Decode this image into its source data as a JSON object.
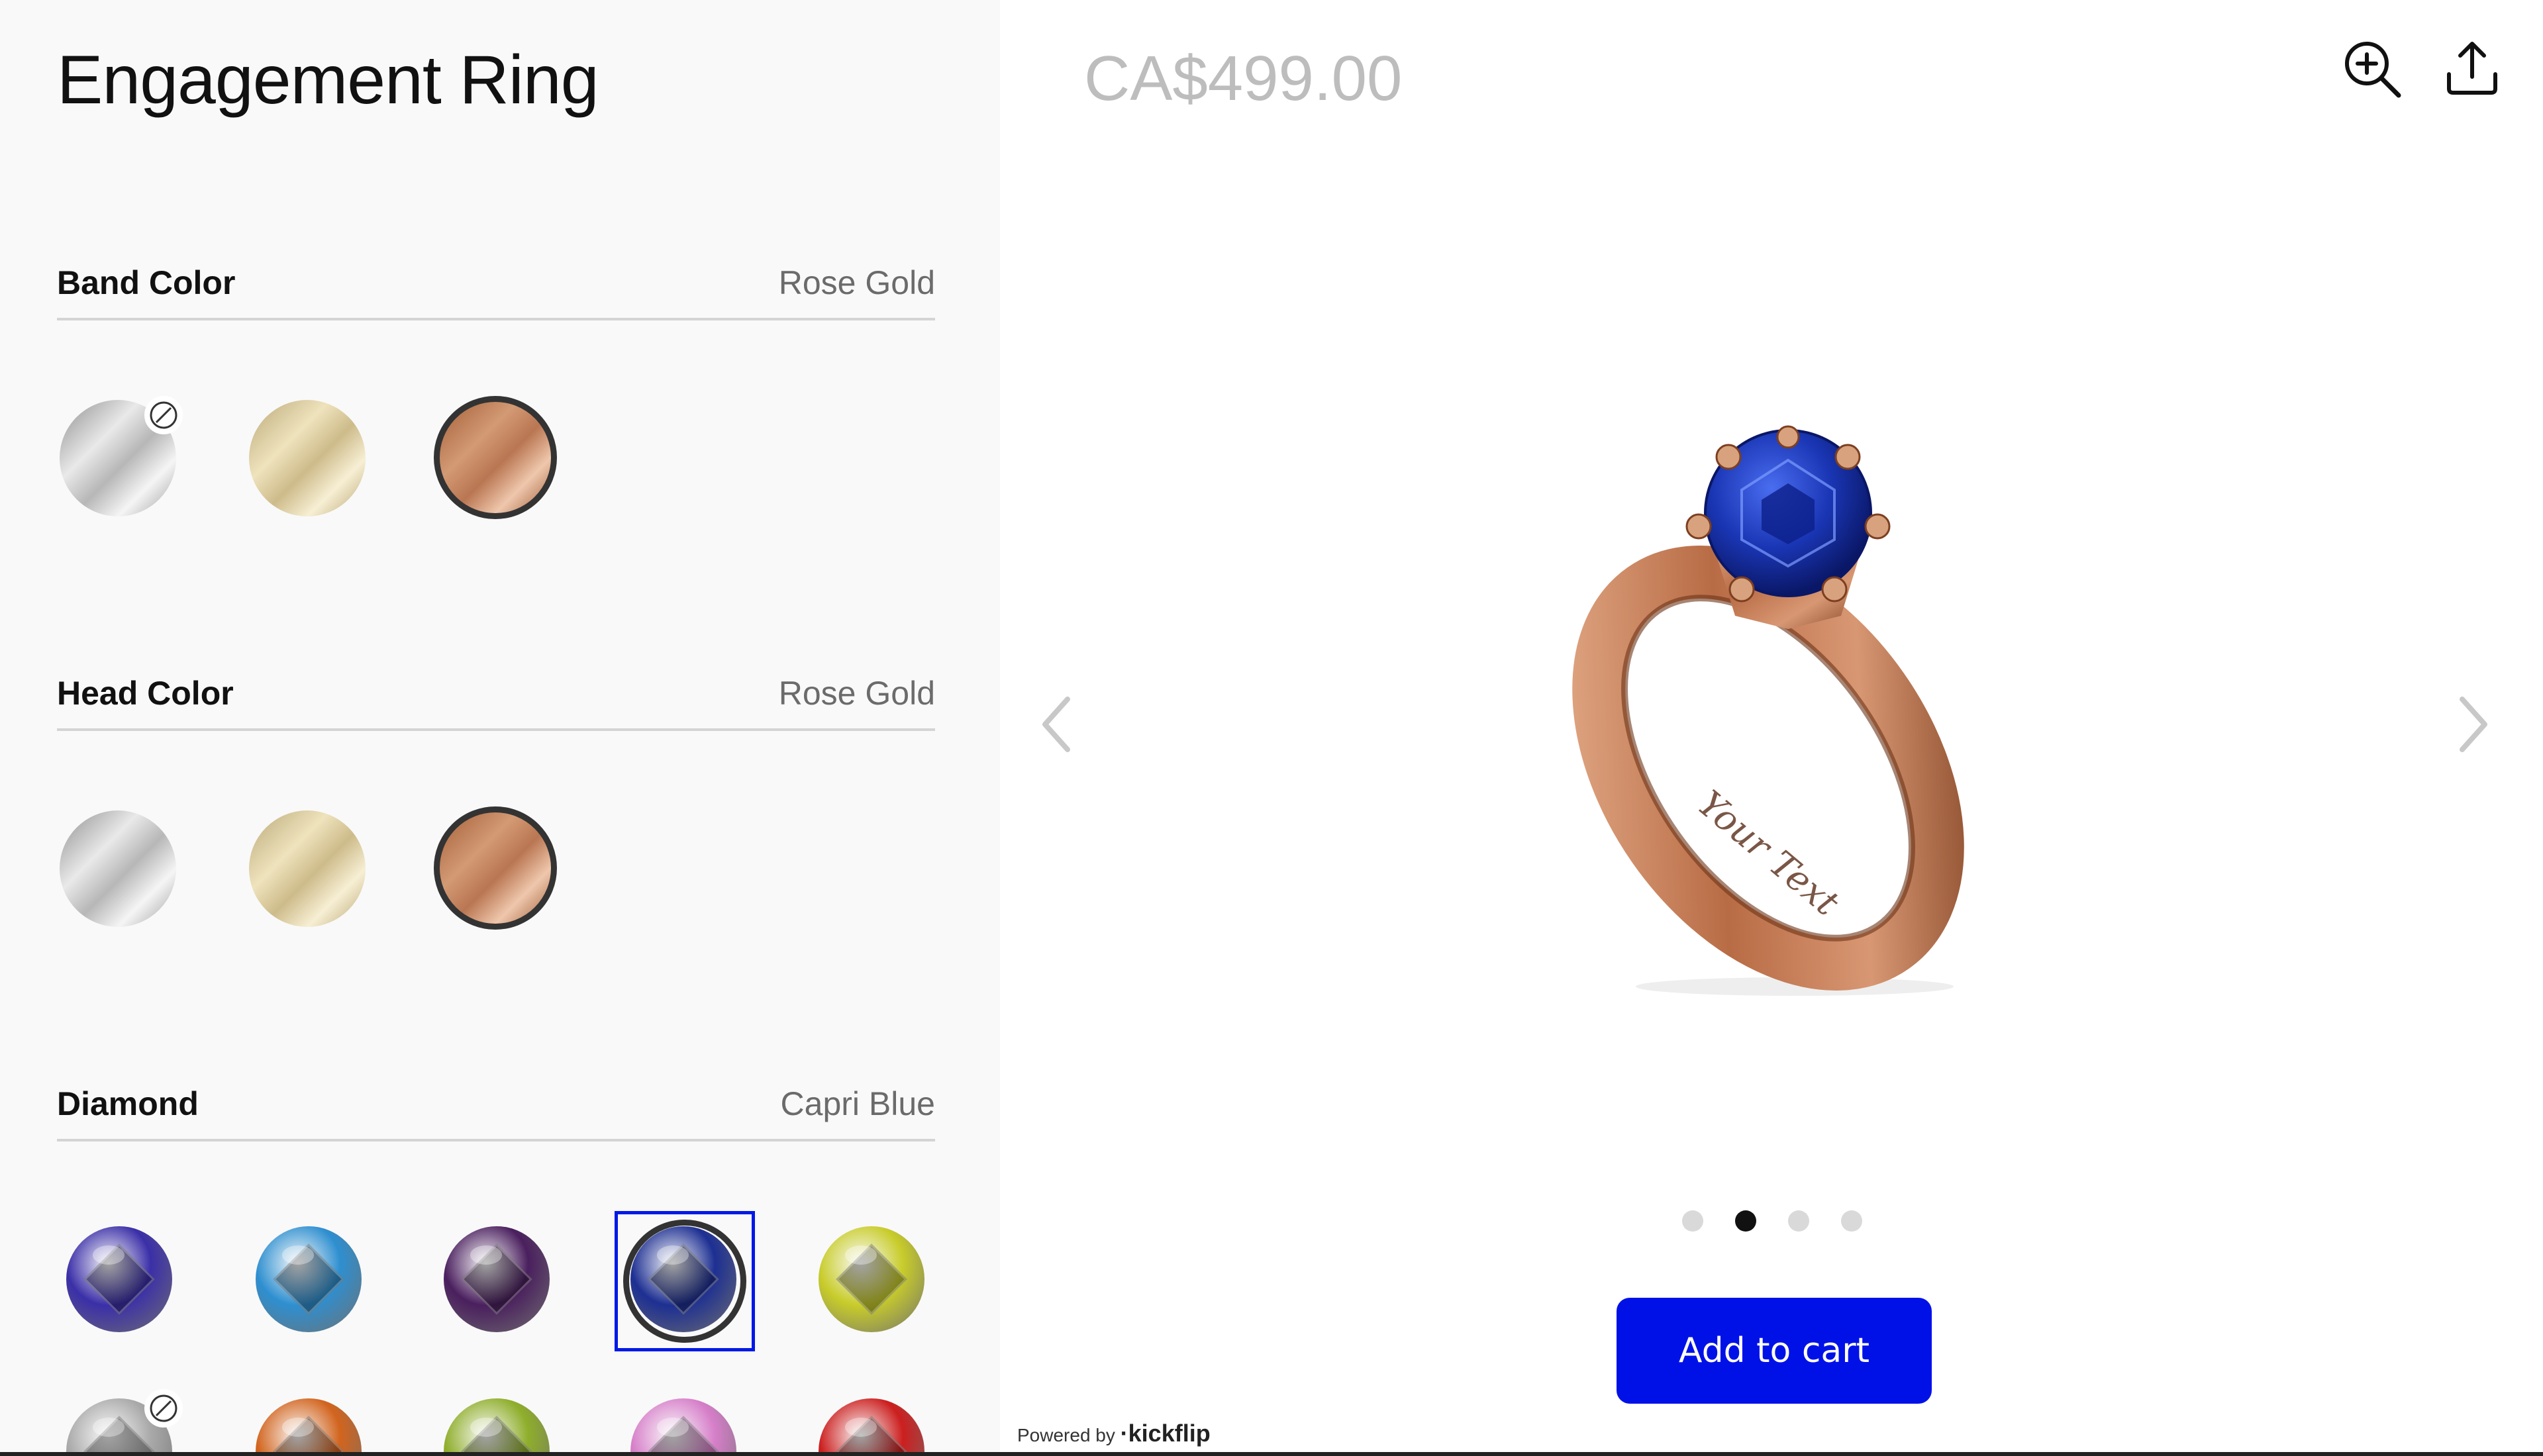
{
  "product": {
    "title": "Engagement Ring",
    "price": "CA$499.00"
  },
  "sections": {
    "band": {
      "label": "Band Color",
      "value": "Rose Gold",
      "options": [
        "Silver",
        "Gold",
        "Rose Gold"
      ],
      "selected": "Rose Gold"
    },
    "head": {
      "label": "Head Color",
      "value": "Rose Gold",
      "options": [
        "Silver",
        "Gold",
        "Rose Gold"
      ],
      "selected": "Rose Gold"
    },
    "diamond": {
      "label": "Diamond",
      "value": "Capri Blue",
      "row1_colors": [
        "#3b2fa8",
        "#2e8fd0",
        "#4a1f5e",
        "#1d2f92",
        "#c8cc2a"
      ],
      "row2_colors": [
        "#a9a9a9",
        "#d2641e",
        "#8fae2b",
        "#d67fc9",
        "#cc1f1f"
      ]
    }
  },
  "engraving": "Your Text",
  "carousel": {
    "count": 4,
    "active": 2
  },
  "actions": {
    "add_to_cart": "Add to cart"
  },
  "footer": {
    "powered_by": "Powered by",
    "brand": "·kickflip"
  },
  "colors": {
    "accent": "#0011e8",
    "rose_gold": "#b97652"
  },
  "icons": {
    "zoom": "zoom-in-icon",
    "share": "share-icon",
    "prev": "chevron-left-icon",
    "next": "chevron-right-icon",
    "unavailable": "not-available-icon"
  }
}
